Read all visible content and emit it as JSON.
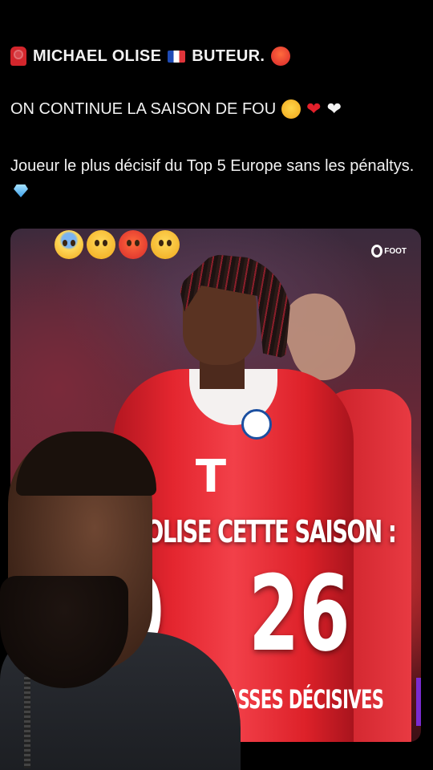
{
  "post": {
    "title": "MICHAEL OLISE",
    "title_suffix": "BUTEUR.",
    "line2": "ON CONTINUE LA SAISON DE FOU",
    "line3": "Joueur le plus décisif du Top 5 Europe sans les pénaltys."
  },
  "card": {
    "logo_text": "FOOT",
    "heading": "OLISE CETTE SAISON :",
    "stat_left": "9",
    "stat_right": "26",
    "caption": "ASSES DÉCISIVES"
  },
  "icons": {
    "title_lead": "rotating-light-icon",
    "flag": "france-flag-icon",
    "title_end": "hot-face-icon",
    "line2_emojis": [
      "star-struck-icon",
      "red-heart-icon",
      "white-heart-icon"
    ],
    "line3_end": "gem-icon",
    "card_emojis": [
      "screaming-face-icon",
      "flushed-face-icon",
      "hot-face-icon",
      "monocle-face-icon"
    ]
  },
  "colors": {
    "background": "#000000",
    "text": "#f2f2f2",
    "jersey_red": "#e4262f"
  }
}
